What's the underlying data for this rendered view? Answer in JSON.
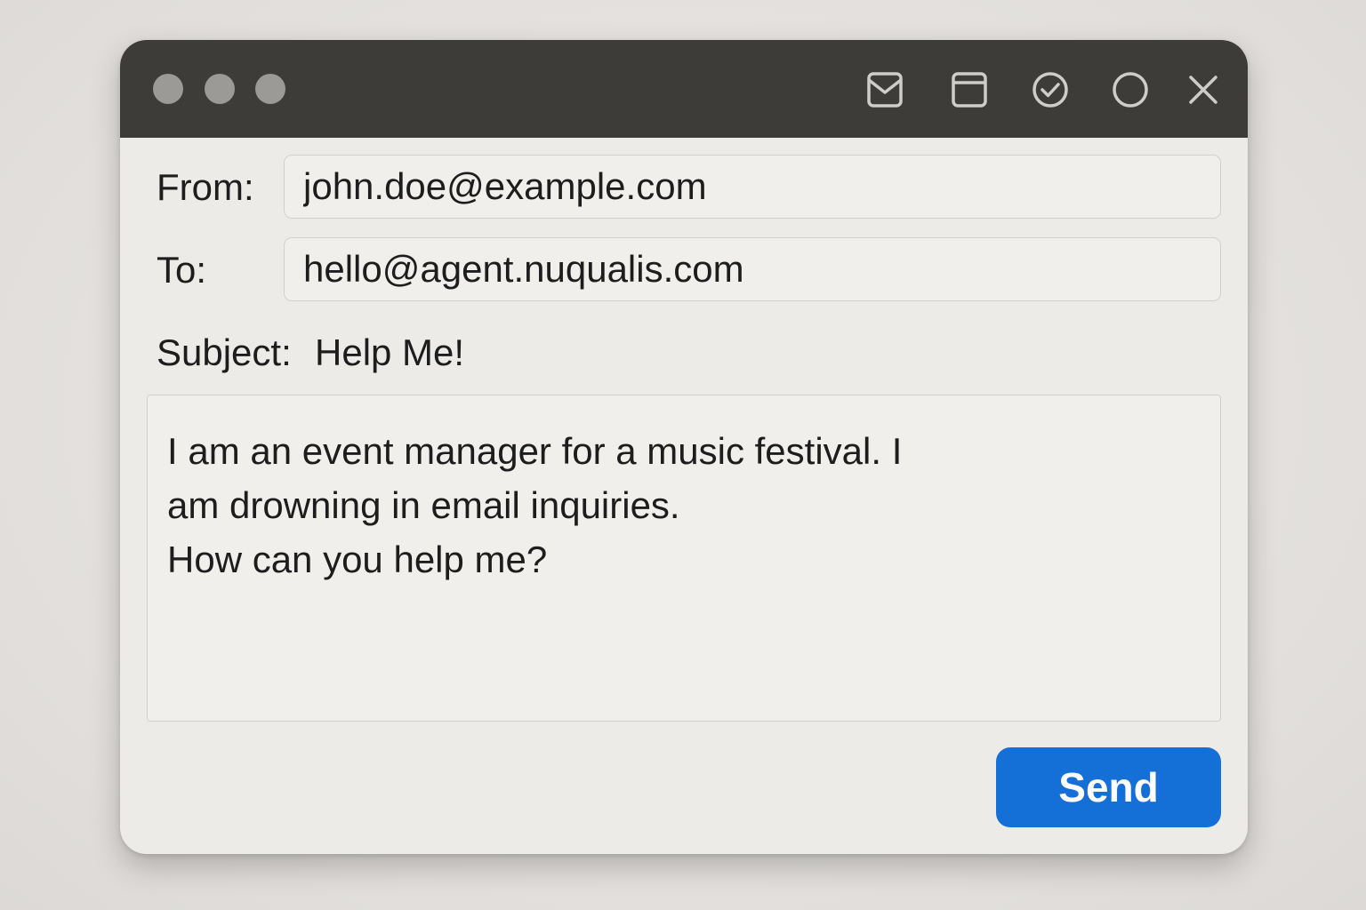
{
  "titlebar": {
    "icons": [
      "mail-icon",
      "window-icon",
      "check-circle-icon",
      "circle-icon",
      "close-icon"
    ],
    "bar_color": "#3d3c38",
    "dot_color": "#9b9a96"
  },
  "compose": {
    "from_label": "From:",
    "from_value": "john.doe@example.com",
    "to_label": "To:",
    "to_value": "hello@agent.nuqualis.com",
    "subject_label": "Subject:",
    "subject_value": "Help Me!",
    "body_lines": [
      "I am an event manager for a music festival. I",
      "am drowning in email inquiries.",
      "How can you help me?"
    ],
    "send_label": "Send"
  },
  "colors": {
    "accent": "#1470d6",
    "window_bg": "#edebe8"
  }
}
